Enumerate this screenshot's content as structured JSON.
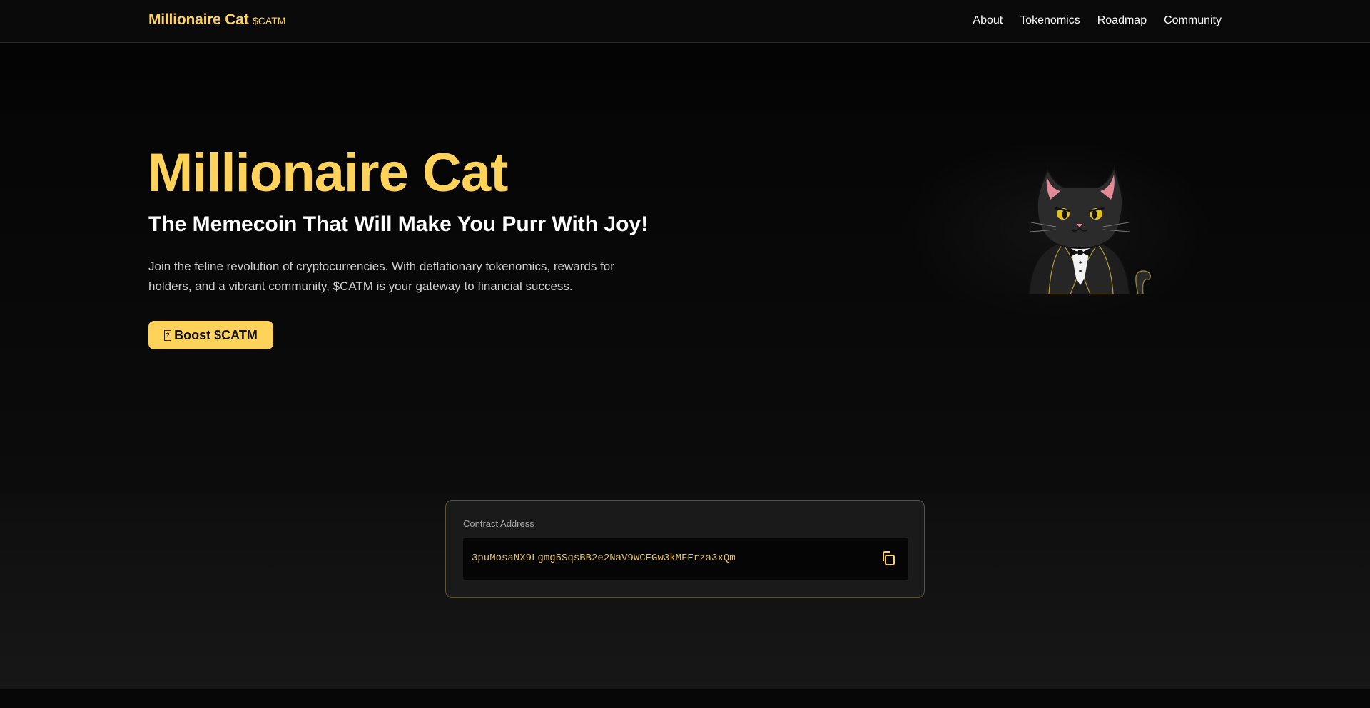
{
  "nav": {
    "brand": "Millionaire Cat",
    "ticker": "$CATM",
    "links": [
      "About",
      "Tokenomics",
      "Roadmap",
      "Community"
    ]
  },
  "hero": {
    "title": "Millionaire Cat",
    "subtitle": "The Memecoin That Will Make You Purr With Joy!",
    "description": "Join the feline revolution of cryptocurrencies. With deflationary tokenomics, rewards for holders, and a vibrant community, $CATM is your gateway to financial success.",
    "cta_icon": "?",
    "cta_label": "Boost $CATM",
    "image": "cat-in-tuxedo-illustration"
  },
  "contract": {
    "label": "Contract Address",
    "address": "3puMosaNX9Lgmg5SqsBB2e2NaV9WCEGw3kMFErza3xQm",
    "copy_icon": "copy-icon"
  },
  "colors": {
    "accent": "#ffd35a",
    "background": "#0b0b0b",
    "card": "#1a1a1a",
    "card_border": "#5a5432",
    "address_text": "#e7c25a"
  }
}
